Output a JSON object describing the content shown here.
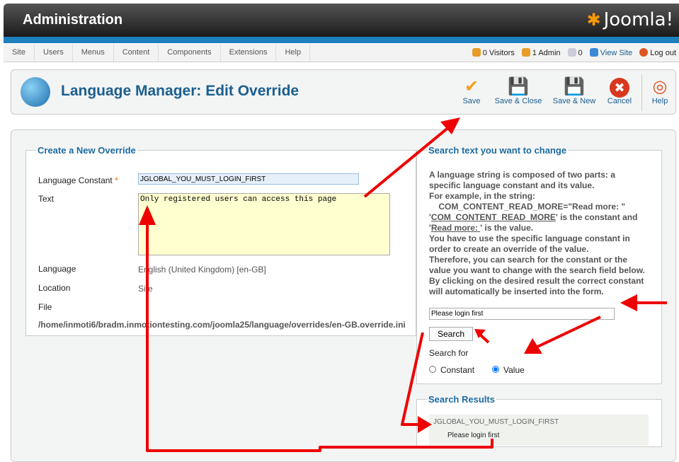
{
  "header": {
    "title": "Administration",
    "logo": "Joomla!"
  },
  "menu": [
    "Site",
    "Users",
    "Menus",
    "Content",
    "Components",
    "Extensions",
    "Help"
  ],
  "status": {
    "visitors": "0 Visitors",
    "admin": "1 Admin",
    "messages": "0",
    "view_site": "View Site",
    "logout": "Log out"
  },
  "toolbar": {
    "title": "Language Manager: Edit Override",
    "save": "Save",
    "save_close": "Save & Close",
    "save_new": "Save & New",
    "cancel": "Cancel",
    "help": "Help"
  },
  "form": {
    "legend": "Create a New Override",
    "constant_label": "Language Constant",
    "required": "*",
    "constant_value": "JGLOBAL_YOU_MUST_LOGIN_FIRST",
    "text_label": "Text",
    "text_value": "Only registered users can access this page",
    "language_label": "Language",
    "language_value": "English (United Kingdom) [en-GB]",
    "location_label": "Location",
    "location_value": "Site",
    "file_label": "File",
    "file_value": "/home/inmoti6/bradm.inmotiontesting.com/joomla25/language/overrides/en-GB.override.ini"
  },
  "search": {
    "legend": "Search text you want to change",
    "help": [
      "A language string is composed of two parts: a specific language constant and its value.",
      "For example, in the string:",
      "COM_CONTENT_READ_MORE=\"Read more: \"",
      "'",
      "COM_CONTENT_READ_MORE",
      "' is the constant and",
      "'",
      "Read more: ",
      "' is the value.",
      "You have to use the specific language constant in order to create an override of the value.",
      "Therefore, you can search for the constant or the value you want to change with the search field below.",
      "By clicking on the desired result the correct constant will automatically be inserted into the form."
    ],
    "input_value": "Please login first",
    "button": "Search",
    "search_for": "Search for",
    "opt_constant": "Constant",
    "opt_value": "Value",
    "selected": "Value"
  },
  "results": {
    "legend": "Search Results",
    "items": [
      {
        "constant": "JGLOBAL_YOU_MUST_LOGIN_FIRST",
        "value": "Please login first"
      }
    ]
  },
  "colors": {
    "accent": "#1b6aa0",
    "annotation": "#e00000"
  }
}
